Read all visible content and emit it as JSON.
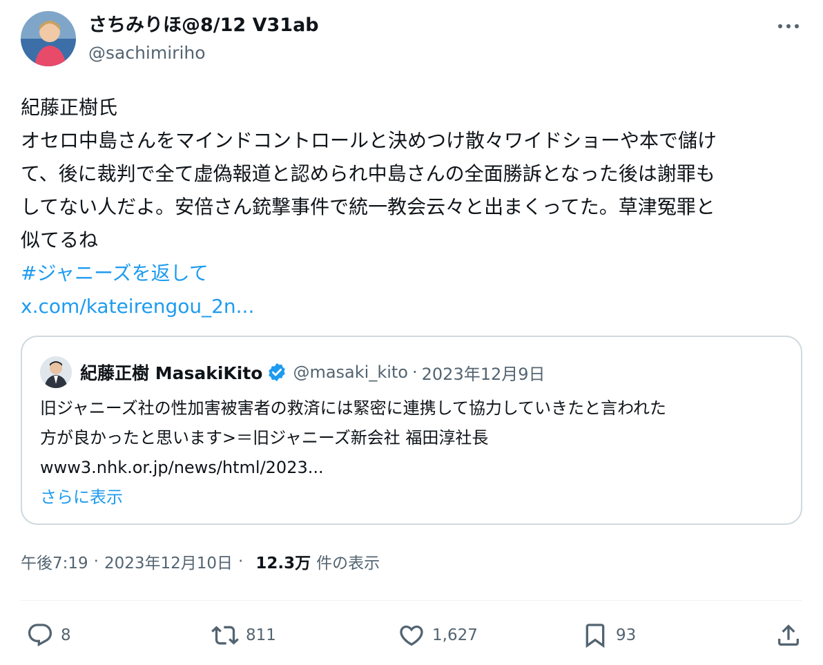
{
  "tweet": {
    "author": {
      "name": "さちみりほ@8/12 V31ab",
      "handle": "@sachimiriho",
      "avatar_icon": "user-avatar"
    },
    "more_icon": "more-horizontal-icon",
    "text_lines": [
      "紀藤正樹氏",
      "オセロ中島さんをマインドコントロールと決めつけ散々ワイドショーや本で儲け",
      "て、後に裁判で全て虚偽報道と認められ中島さんの全面勝訴となった後は謝罪も",
      "してない人だよ。安倍さん銃撃事件で統一教会云々と出まくってた。草津冤罪と",
      "似てるね"
    ],
    "hashtag": "#ジャニーズを返して",
    "link": "x.com/kateirengou_2n..."
  },
  "quoted": {
    "name": "紀藤正樹 MasakiKito",
    "verified_icon": "verified-badge-icon",
    "handle": "@masaki_kito",
    "separator": "·",
    "date": "2023年12月9日",
    "body_lines": [
      "旧ジャニーズ社の性加害被害者の救済には緊密に連携して協力していきたと言われた",
      "方が良かったと思います>＝旧ジャニーズ新会社 福田淳社長",
      "www3.nhk.or.jp/news/html/2023..."
    ],
    "show_more": "さらに表示"
  },
  "meta": {
    "time": "午後7:19",
    "separator": "·",
    "date": "2023年12月10日",
    "views": "12.3万",
    "views_label": "件の表示"
  },
  "actions": {
    "reply": {
      "icon": "reply-icon",
      "count": "8"
    },
    "retweet": {
      "icon": "retweet-icon",
      "count": "811"
    },
    "like": {
      "icon": "heart-icon",
      "count": "1,627"
    },
    "bookmark": {
      "icon": "bookmark-icon",
      "count": "93"
    },
    "share": {
      "icon": "share-icon"
    }
  },
  "colors": {
    "link": "#1d9bf0",
    "secondary_text": "#536471",
    "border": "#cfd9de",
    "verified": "#1d9bf0"
  }
}
